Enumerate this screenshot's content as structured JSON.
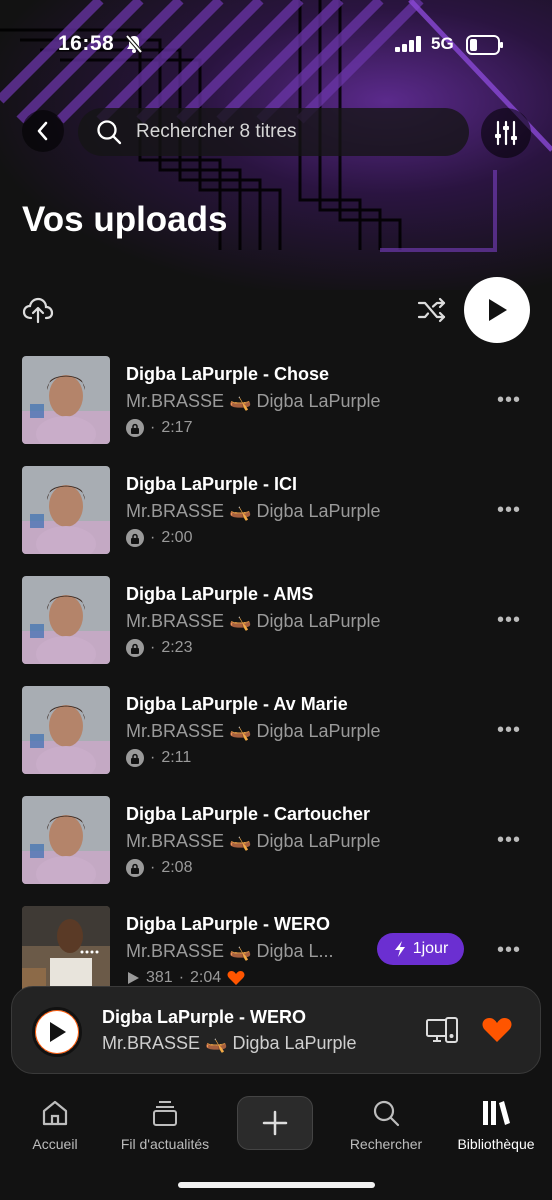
{
  "status": {
    "time": "16:58",
    "network": "5G"
  },
  "search": {
    "placeholder": "Rechercher 8 titres"
  },
  "page_title": "Vos uploads",
  "tracks": [
    {
      "title": "Digba LaPurple  - Chose",
      "artist": "Mr.BRASSE 🛶 Digba LaPurple",
      "duration": "2:17",
      "private": true
    },
    {
      "title": "Digba LaPurple  - ICI",
      "artist": "Mr.BRASSE 🛶 Digba LaPurple",
      "duration": "2:00",
      "private": true
    },
    {
      "title": "Digba LaPurple  - AMS",
      "artist": "Mr.BRASSE 🛶 Digba LaPurple",
      "duration": "2:23",
      "private": true
    },
    {
      "title": "Digba LaPurple  - Av Marie",
      "artist": "Mr.BRASSE 🛶 Digba LaPurple",
      "duration": "2:11",
      "private": true
    },
    {
      "title": "Digba LaPurple  - Cartoucher",
      "artist": "Mr.BRASSE 🛶 Digba LaPurple",
      "duration": "2:08",
      "private": true
    },
    {
      "title": "Digba LaPurple  - WERO",
      "artist": "Mr.BRASSE 🛶 Digba L...",
      "plays": "381",
      "duration": "2:04",
      "badge": "1jour",
      "liked": true
    }
  ],
  "now_playing": {
    "title": "Digba LaPurple  - WERO",
    "artist": "Mr.BRASSE 🛶 Digba LaPurple"
  },
  "tabs": [
    {
      "label": "Accueil"
    },
    {
      "label": "Fil d'actualités"
    },
    {
      "label": "Rechercher"
    },
    {
      "label": "Bibliothèque"
    }
  ],
  "colors": {
    "accent": "#ff5500",
    "badge": "#6b2fd1",
    "background": "#121212"
  }
}
